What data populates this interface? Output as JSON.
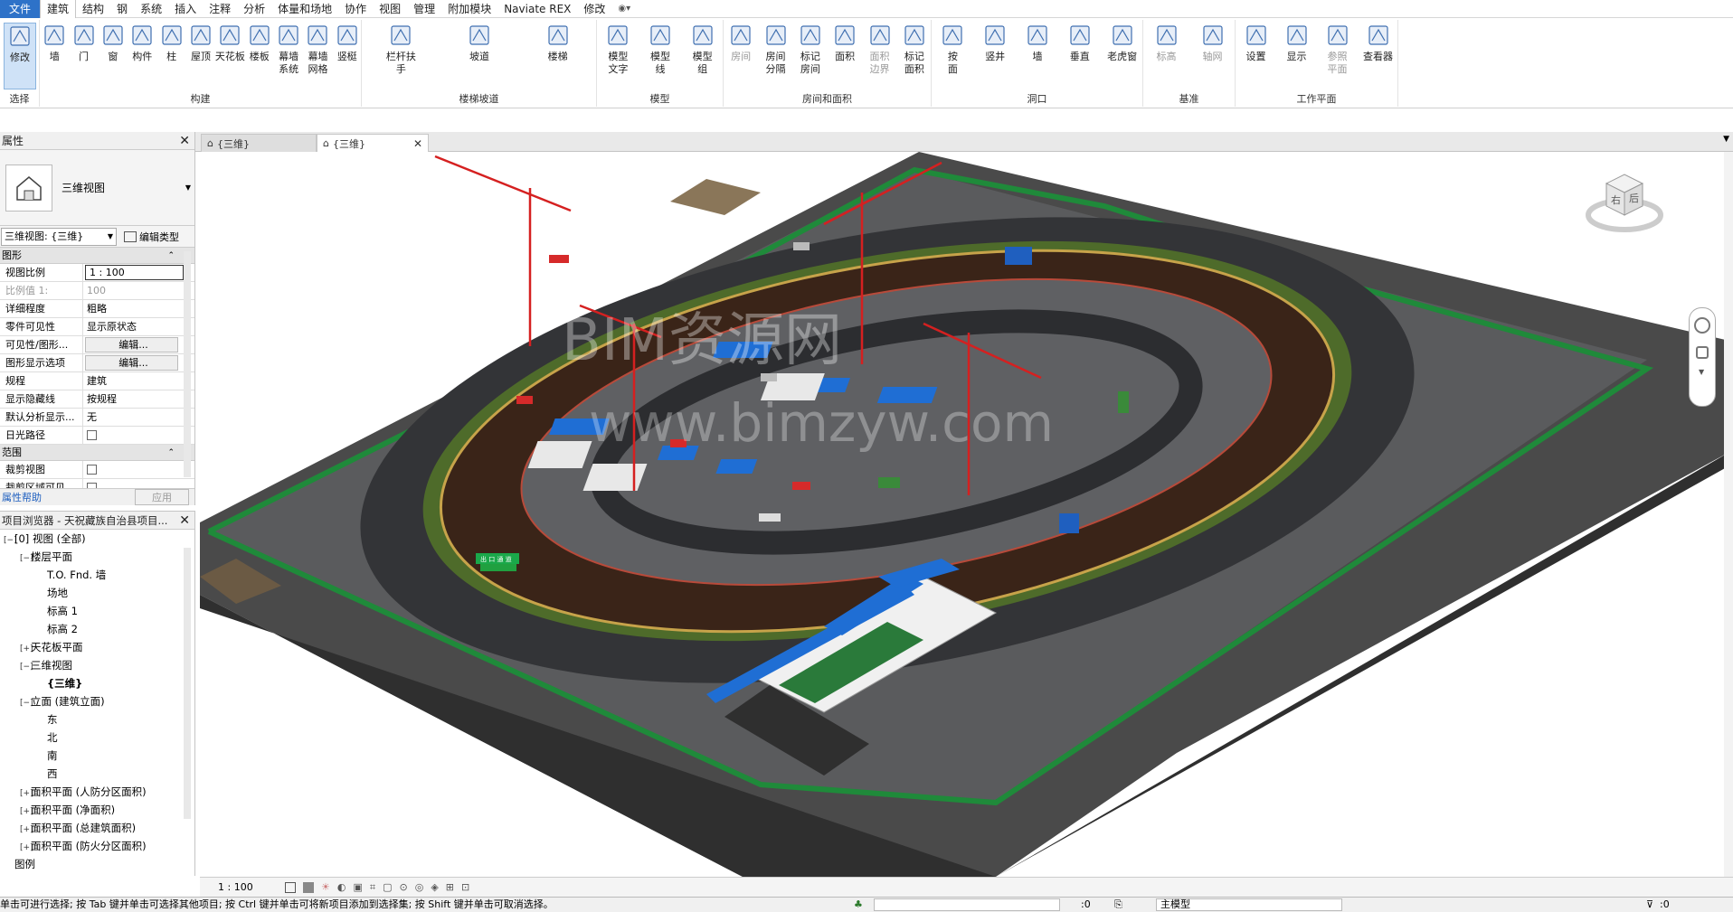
{
  "menus": [
    "文件",
    "建筑",
    "结构",
    "钢",
    "系统",
    "插入",
    "注释",
    "分析",
    "体量和场地",
    "协作",
    "视图",
    "管理",
    "附加模块",
    "Naviate REX",
    "修改"
  ],
  "ribbon": {
    "groups": [
      {
        "title": "选择",
        "buttons": [
          {
            "label": "修改",
            "icon": "cursor-icon"
          }
        ]
      },
      {
        "title": "构建",
        "buttons": [
          {
            "label": "墙",
            "icon": "wall-icon"
          },
          {
            "label": "门",
            "icon": "door-icon"
          },
          {
            "label": "窗",
            "icon": "window-icon"
          },
          {
            "label": "构件",
            "icon": "component-icon"
          },
          {
            "label": "柱",
            "icon": "column-icon"
          },
          {
            "label": "屋顶",
            "icon": "roof-icon"
          },
          {
            "label": "天花板",
            "icon": "ceiling-icon"
          },
          {
            "label": "楼板",
            "icon": "floor-icon"
          },
          {
            "label": "幕墙\n系统",
            "icon": "curtain-system-icon"
          },
          {
            "label": "幕墙\n网格",
            "icon": "curtain-grid-icon"
          },
          {
            "label": "竖梃",
            "icon": "mullion-icon"
          }
        ]
      },
      {
        "title": "楼梯坡道",
        "buttons": [
          {
            "label": "栏杆扶手",
            "icon": "railing-icon"
          },
          {
            "label": "坡道",
            "icon": "ramp-icon"
          },
          {
            "label": "楼梯",
            "icon": "stair-icon"
          }
        ]
      },
      {
        "title": "模型",
        "buttons": [
          {
            "label": "模型\n文字",
            "icon": "model-text-icon"
          },
          {
            "label": "模型\n线",
            "icon": "model-line-icon"
          },
          {
            "label": "模型\n组",
            "icon": "model-group-icon"
          }
        ]
      },
      {
        "title": "房间和面积",
        "buttons": [
          {
            "label": "房间",
            "icon": "room-icon"
          },
          {
            "label": "房间\n分隔",
            "icon": "room-separator-icon"
          },
          {
            "label": "标记\n房间",
            "icon": "tag-room-icon"
          },
          {
            "label": "面积",
            "icon": "area-icon"
          },
          {
            "label": "面积\n边界",
            "icon": "area-boundary-icon"
          },
          {
            "label": "标记\n面积",
            "icon": "tag-area-icon"
          }
        ]
      },
      {
        "title": "洞口",
        "buttons": [
          {
            "label": "按\n面",
            "icon": "opening-face-icon"
          },
          {
            "label": "竖井",
            "icon": "shaft-icon"
          },
          {
            "label": "墙",
            "icon": "wall-opening-icon"
          },
          {
            "label": "垂直",
            "icon": "vertical-opening-icon"
          },
          {
            "label": "老虎窗",
            "icon": "dormer-icon"
          }
        ]
      },
      {
        "title": "基准",
        "buttons": [
          {
            "label": "标高",
            "icon": "level-icon"
          },
          {
            "label": "轴网",
            "icon": "grid-icon"
          }
        ]
      },
      {
        "title": "工作平面",
        "buttons": [
          {
            "label": "设置",
            "icon": "set-workplane-icon"
          },
          {
            "label": "显示",
            "icon": "show-workplane-icon"
          },
          {
            "label": "参照\n平面",
            "icon": "ref-plane-icon"
          },
          {
            "label": "查看器",
            "icon": "viewer-icon"
          }
        ]
      }
    ]
  },
  "tabs": [
    {
      "label": "{三维}",
      "active": false
    },
    {
      "label": "{三维}",
      "active": true
    }
  ],
  "properties": {
    "title": "属性",
    "type_name": "三维视图",
    "view_selector": "三维视图: {三维}",
    "edit_type": "编辑类型",
    "section_graphics": "图形",
    "rows": [
      {
        "k": "视图比例",
        "v": "1 : 100"
      },
      {
        "k": "比例值 1:",
        "v": "100"
      },
      {
        "k": "详细程度",
        "v": "粗略"
      },
      {
        "k": "零件可见性",
        "v": "显示原状态"
      },
      {
        "k": "可见性/图形...",
        "v": "编辑..."
      },
      {
        "k": "图形显示选项",
        "v": "编辑..."
      },
      {
        "k": "规程",
        "v": "建筑"
      },
      {
        "k": "显示隐藏线",
        "v": "按规程"
      },
      {
        "k": "默认分析显示...",
        "v": "无"
      },
      {
        "k": "日光路径",
        "v": ""
      }
    ],
    "section_extent": "范围",
    "rows2": [
      {
        "k": "裁剪视图",
        "v": ""
      },
      {
        "k": "裁剪区域可见",
        "v": ""
      }
    ],
    "help": "属性帮助",
    "apply": "应用"
  },
  "browser": {
    "title": "项目浏览器 - 天祝藏族自治县项目...",
    "items": [
      {
        "label": "[0] 视图 (全部)",
        "lvl": 0,
        "exp": "−"
      },
      {
        "label": "楼层平面",
        "lvl": 1,
        "exp": "−"
      },
      {
        "label": "T.O. Fnd. 墙",
        "lvl": 2,
        "exp": ""
      },
      {
        "label": "场地",
        "lvl": 2,
        "exp": ""
      },
      {
        "label": "标高 1",
        "lvl": 2,
        "exp": ""
      },
      {
        "label": "标高 2",
        "lvl": 2,
        "exp": ""
      },
      {
        "label": "天花板平面",
        "lvl": 1,
        "exp": "+"
      },
      {
        "label": "三维视图",
        "lvl": 1,
        "exp": "−"
      },
      {
        "label": "{三维}",
        "lvl": 2,
        "exp": ""
      },
      {
        "label": "立面 (建筑立面)",
        "lvl": 1,
        "exp": "−"
      },
      {
        "label": "东",
        "lvl": 2,
        "exp": ""
      },
      {
        "label": "北",
        "lvl": 2,
        "exp": ""
      },
      {
        "label": "南",
        "lvl": 2,
        "exp": ""
      },
      {
        "label": "西",
        "lvl": 2,
        "exp": ""
      },
      {
        "label": "面积平面 (人防分区面积)",
        "lvl": 1,
        "exp": "+"
      },
      {
        "label": "面积平面 (净面积)",
        "lvl": 1,
        "exp": "+"
      },
      {
        "label": "面积平面 (总建筑面积)",
        "lvl": 1,
        "exp": "+"
      },
      {
        "label": "面积平面 (防火分区面积)",
        "lvl": 1,
        "exp": "+"
      },
      {
        "label": "图例",
        "lvl": 0,
        "exp": ""
      }
    ]
  },
  "viewport": {
    "watermark1": "BIM资源网",
    "watermark2": "www.bimzyw.com",
    "viewcube_right": "右",
    "viewcube_back": "后",
    "gate_sign": "出 口 通 道"
  },
  "viewbar": {
    "scale": "1 : 100"
  },
  "status": {
    "hint": "单击可进行选择; 按 Tab 键并单击可选择其他项目; 按 Ctrl 键并单击可将新项目添加到选择集; 按 Shift 键并单击可取消选择。",
    "count": ":0",
    "model": "主模型",
    "filter_count": ":0"
  }
}
